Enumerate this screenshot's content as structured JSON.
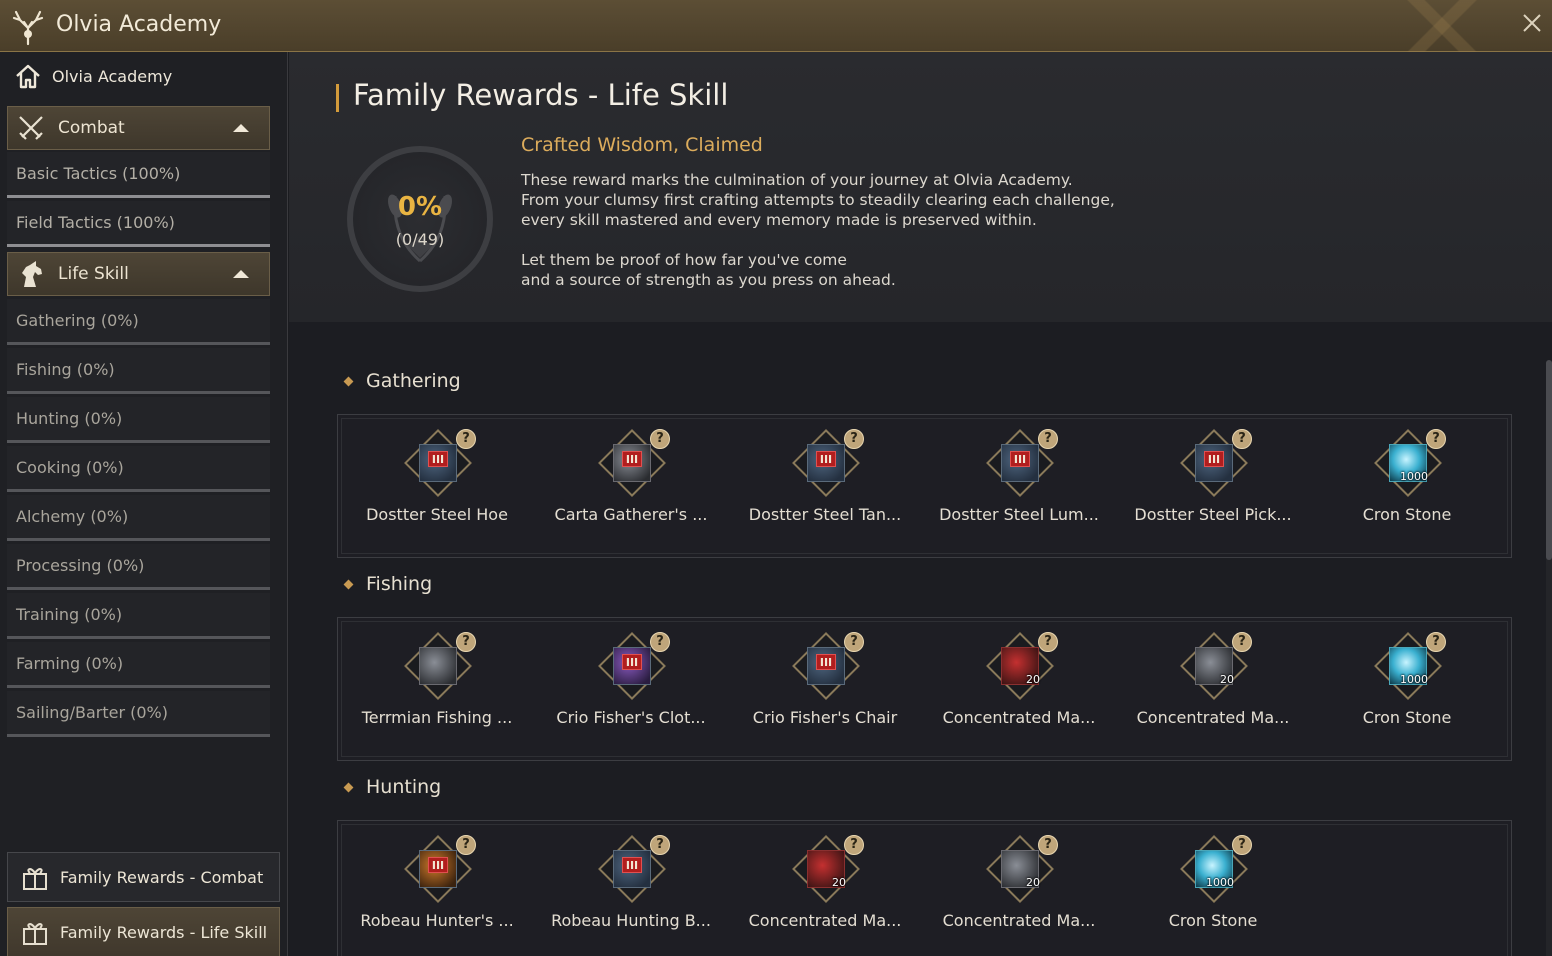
{
  "window": {
    "title": "Olvia Academy",
    "logo_icon": "deer-antler-icon",
    "close_icon": "close-icon"
  },
  "sidebar": {
    "home": {
      "label": "Olvia Academy",
      "icon": "home-icon"
    },
    "categories": [
      {
        "label": "Combat",
        "icon": "crossed-swords-icon",
        "items": [
          "Basic Tactics (100%)",
          "Field Tactics (100%)"
        ]
      },
      {
        "label": "Life Skill",
        "icon": "horse-head-icon",
        "items": [
          "Gathering (0%)",
          "Fishing (0%)",
          "Hunting (0%)",
          "Cooking (0%)",
          "Alchemy (0%)",
          "Processing (0%)",
          "Training (0%)",
          "Farming (0%)",
          "Sailing/Barter (0%)"
        ]
      }
    ],
    "family_rewards": [
      {
        "label": "Family Rewards - Combat",
        "icon": "gift-icon",
        "active": false
      },
      {
        "label": "Family Rewards - Life Skill",
        "icon": "gift-icon",
        "active": true
      }
    ]
  },
  "main": {
    "title": "Family Rewards - Life Skill",
    "progress": {
      "percent": "0%",
      "count": "(0/49)",
      "value": 0
    },
    "reward_title": "Crafted Wisdom, Claimed",
    "reward_desc_1": "These reward marks the culmination of your journey at Olvia Academy.\nFrom your clumsy first crafting attempts to steadily clearing each challenge,\nevery skill mastered and every memory made is preserved within.",
    "reward_desc_2": "Let them be proof of how far you've come\nand a source of strength as you press on ahead.",
    "sections": [
      {
        "label": "Gathering",
        "items": [
          {
            "name": "Dostter Steel Hoe",
            "grade": "III",
            "style": "blue"
          },
          {
            "name": "Carta Gatherer's ...",
            "grade": "III",
            "style": "gray"
          },
          {
            "name": "Dostter Steel Tan...",
            "grade": "III",
            "style": "blue"
          },
          {
            "name": "Dostter Steel Lum...",
            "grade": "III",
            "style": "blue"
          },
          {
            "name": "Dostter Steel Pick...",
            "grade": "III",
            "style": "blue"
          },
          {
            "name": "Cron Stone",
            "qty": "1000",
            "style": "cyan"
          }
        ]
      },
      {
        "label": "Fishing",
        "items": [
          {
            "name": "Terrmian Fishing ...",
            "style": "gray"
          },
          {
            "name": "Crio Fisher's Clot...",
            "grade": "III",
            "style": "purple"
          },
          {
            "name": "Crio Fisher's Chair",
            "grade": "III",
            "style": "blue"
          },
          {
            "name": "Concentrated Ma...",
            "qty": "20",
            "style": "red"
          },
          {
            "name": "Concentrated Ma...",
            "qty": "20",
            "style": "gray"
          },
          {
            "name": "Cron Stone",
            "qty": "1000",
            "style": "cyan"
          }
        ]
      },
      {
        "label": "Hunting",
        "items": [
          {
            "name": "Robeau Hunter's ...",
            "grade": "III",
            "style": "orange"
          },
          {
            "name": "Robeau Hunting B...",
            "grade": "III",
            "style": "blue"
          },
          {
            "name": "Concentrated Ma...",
            "qty": "20",
            "style": "red"
          },
          {
            "name": "Concentrated Ma...",
            "qty": "20",
            "style": "gray"
          },
          {
            "name": "Cron Stone",
            "qty": "1000",
            "style": "cyan"
          }
        ]
      }
    ],
    "help_glyph": "?"
  }
}
